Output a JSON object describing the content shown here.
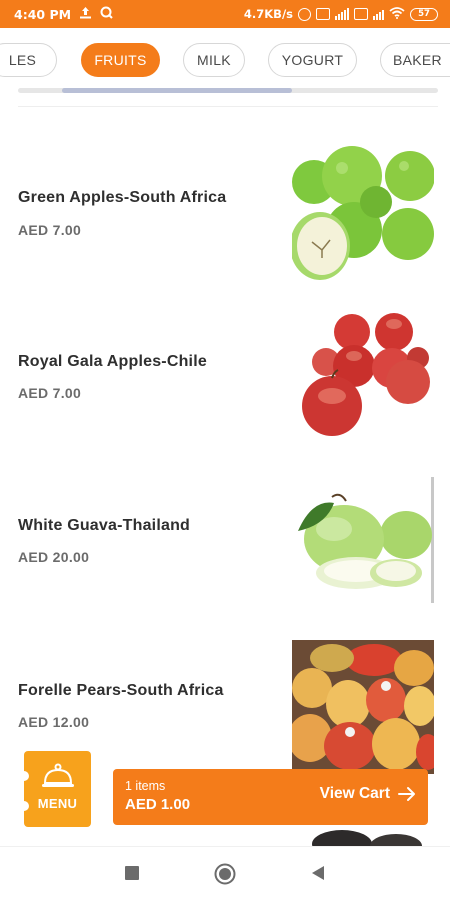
{
  "status_bar": {
    "time": "4:40 PM",
    "speed": "4.7KB/s",
    "battery": "57",
    "background_color": "#f47c1a"
  },
  "categories": {
    "items": [
      "LES",
      "FRUITS",
      "MILK",
      "YOGURT",
      "BAKER"
    ],
    "selected": "FRUITS",
    "accent_color": "#f47c1a"
  },
  "products": [
    {
      "name": "Green Apples-South Africa",
      "price": "AED 7.00",
      "image_icon": "green-apples-image"
    },
    {
      "name": "Royal Gala Apples-Chile",
      "price": "AED 7.00",
      "image_icon": "red-apples-image"
    },
    {
      "name": "White Guava-Thailand",
      "price": "AED 20.00",
      "image_icon": "guava-image"
    },
    {
      "name": "Forelle Pears-South Africa",
      "price": "AED 12.00",
      "image_icon": "pears-image"
    }
  ],
  "menu_button": {
    "label": "MENU",
    "icon": "cloche-icon",
    "color": "#f7a21c"
  },
  "cart": {
    "count_label": "1 items",
    "total": "AED 1.00",
    "action_label": "View Cart",
    "color": "#f47c1a"
  },
  "nav_bar": {
    "icons": [
      "recent-apps-icon",
      "home-icon",
      "back-icon"
    ]
  }
}
